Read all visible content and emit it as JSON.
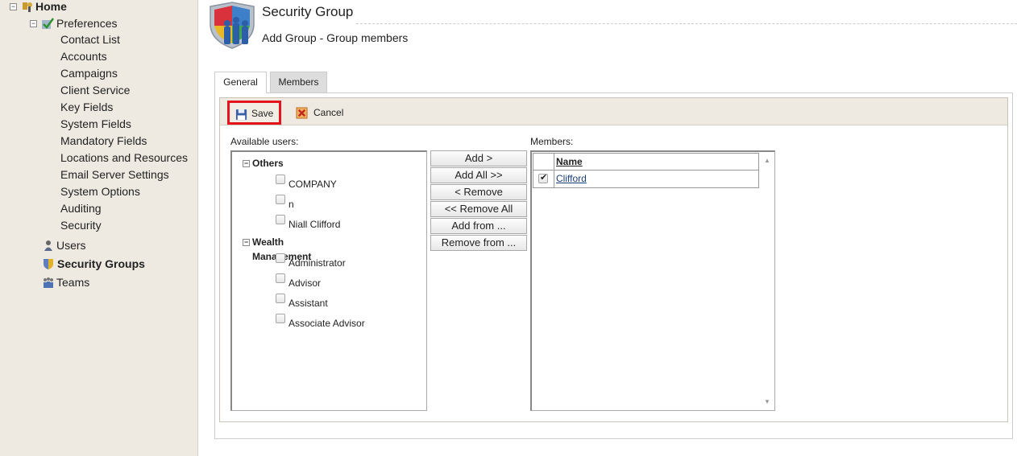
{
  "sidebar": {
    "home": {
      "label": "Home",
      "expander": "⊟"
    },
    "preferences": {
      "label": "Preferences",
      "expander": "⊟"
    },
    "preference_items": [
      "Contact List",
      "Accounts",
      "Campaigns",
      "Client Service",
      "Key Fields",
      "System Fields",
      "Mandatory Fields",
      "Locations and Resources",
      "Email Server Settings",
      "System Options",
      "Auditing",
      "Security"
    ],
    "users": {
      "label": "Users"
    },
    "security_groups": {
      "label": "Security Groups"
    },
    "teams": {
      "label": "Teams"
    }
  },
  "header": {
    "title": "Security Group",
    "subtitle": "Add Group - Group members",
    "logo_icon": "security-group-people-icon"
  },
  "tabs": [
    "General",
    "Members"
  ],
  "toolbar": {
    "save_label": "Save",
    "cancel_label": "Cancel"
  },
  "available": {
    "label": "Available users:",
    "groups": [
      {
        "name": "Others",
        "users": [
          "COMPANY",
          "n",
          "Niall Clifford"
        ]
      },
      {
        "name": "Wealth Management",
        "users": [
          "Administrator",
          "Advisor",
          "Assistant",
          "Associate Advisor"
        ]
      }
    ]
  },
  "actions": [
    "Add >",
    "Add All >>",
    "< Remove",
    "<< Remove All",
    "Add from ...",
    "Remove from ..."
  ],
  "members": {
    "label": "Members:",
    "column": "Name",
    "rows": [
      {
        "name": "Clifford",
        "checked": true
      }
    ]
  },
  "colors": {
    "sidebar_bg": "#eee9e1",
    "save_highlight": "#e3141b"
  }
}
